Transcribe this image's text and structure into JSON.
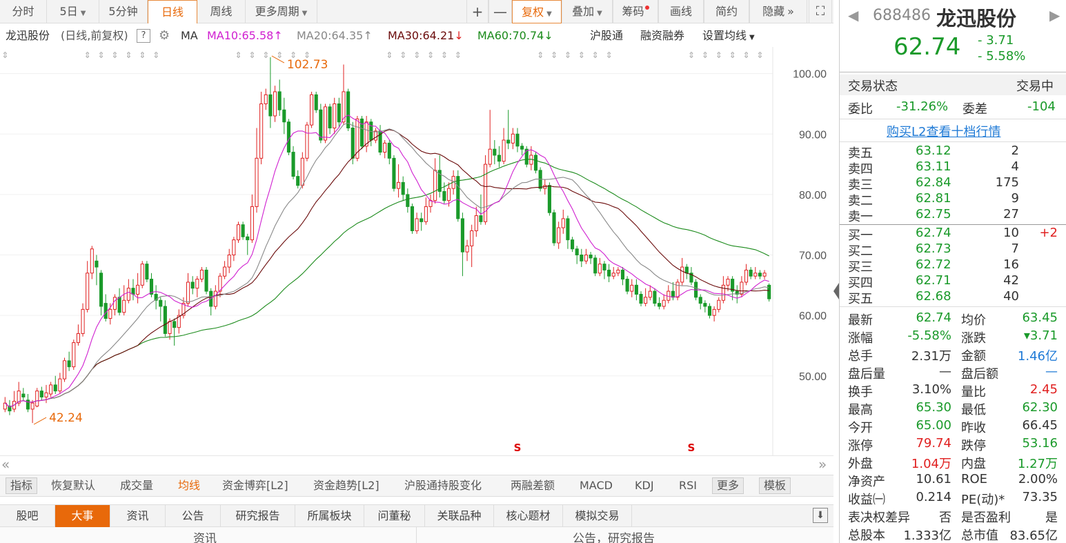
{
  "colors": {
    "up": "#e02020",
    "down": "#1a9a2a",
    "accent": "#e8690a",
    "ma10": "#d020d0",
    "ma20": "#888888",
    "ma30": "#6a0a0a",
    "ma60": "#1a8a1a"
  },
  "toolbar": {
    "items": [
      {
        "label": "分时",
        "w": 68
      },
      {
        "label": "5日",
        "w": 76,
        "caret": true
      },
      {
        "label": "5分钟",
        "w": 70
      },
      {
        "label": "日线",
        "w": 72,
        "active": true
      },
      {
        "label": "周线",
        "w": 70
      },
      {
        "label": "更多周期",
        "w": 104,
        "caret": true
      }
    ],
    "plus": "+",
    "minus": "—",
    "fuquan": "复权",
    "diejia": "叠加",
    "chouma": "筹码",
    "huaxian": "画线",
    "jianyue": "简约",
    "yincang": "隐藏",
    "expand": "»"
  },
  "ma_row": {
    "name": "龙迅股份",
    "sub": "(日线,前复权)",
    "q": "?",
    "ma": "MA",
    "ma10": "MA10:65.58",
    "ma20": "MA20:64.35",
    "ma30": "MA30:64.21",
    "ma60": "MA60:70.74",
    "hgt": "沪股通",
    "rzrq": "融资融券",
    "shezhi": "设置均线"
  },
  "chart_data": {
    "type": "candlestick",
    "y_ticks": [
      "100.00",
      "90.00",
      "80.00",
      "70.00",
      "60.00",
      "50.00"
    ],
    "ylim": [
      40.5,
      103.5
    ],
    "annotations": {
      "high": "102.73",
      "low": "42.24"
    },
    "marker": "S",
    "candles": [
      [
        44.5,
        45.5,
        44.0,
        46.5
      ],
      [
        45.0,
        44.2,
        43.5,
        46.0
      ],
      [
        44.5,
        45.8,
        44.0,
        47.5
      ],
      [
        45.5,
        47.5,
        45.0,
        49.0
      ],
      [
        47.0,
        46.5,
        45.8,
        48.0
      ],
      [
        46.0,
        44.5,
        44.0,
        47.0
      ],
      [
        44.5,
        45.5,
        42.2,
        46.0
      ],
      [
        45.0,
        47.5,
        44.8,
        48.0
      ],
      [
        47.5,
        46.5,
        46.0,
        48.2
      ],
      [
        46.5,
        47.2,
        45.5,
        48.5
      ],
      [
        47.0,
        48.5,
        46.5,
        49.0
      ],
      [
        48.5,
        47.5,
        47.0,
        50.0
      ],
      [
        47.5,
        49.5,
        47.0,
        50.5
      ],
      [
        49.5,
        52.5,
        49.0,
        53.0
      ],
      [
        52.5,
        51.5,
        50.8,
        54.0
      ],
      [
        51.5,
        55.5,
        51.0,
        56.0
      ],
      [
        55.5,
        57.0,
        55.0,
        58.5
      ],
      [
        57.0,
        61.0,
        56.5,
        62.0
      ],
      [
        61.0,
        67.0,
        60.5,
        69.0
      ],
      [
        67.0,
        71.0,
        66.0,
        71.5
      ],
      [
        69.0,
        68.0,
        65.0,
        70.0
      ],
      [
        67.0,
        61.5,
        60.0,
        67.5
      ],
      [
        62.0,
        59.5,
        59.0,
        63.5
      ],
      [
        59.5,
        61.0,
        58.5,
        62.0
      ],
      [
        61.0,
        63.0,
        60.0,
        63.5
      ],
      [
        63.0,
        60.5,
        60.0,
        64.5
      ],
      [
        60.5,
        62.5,
        60.0,
        65.0
      ],
      [
        62.5,
        64.5,
        62.0,
        66.0
      ],
      [
        64.5,
        63.5,
        62.5,
        66.0
      ],
      [
        63.5,
        65.0,
        62.0,
        67.0
      ],
      [
        65.0,
        68.5,
        64.5,
        69.0
      ],
      [
        68.5,
        66.0,
        65.5,
        69.0
      ],
      [
        66.0,
        63.5,
        63.0,
        67.0
      ],
      [
        63.5,
        62.5,
        61.0,
        65.0
      ],
      [
        62.5,
        61.5,
        59.0,
        63.0
      ],
      [
        61.5,
        57.0,
        56.5,
        62.5
      ],
      [
        57.0,
        59.0,
        56.0,
        59.5
      ],
      [
        59.0,
        58.0,
        55.0,
        59.5
      ],
      [
        58.0,
        60.0,
        57.0,
        61.0
      ],
      [
        60.0,
        62.0,
        59.5,
        63.0
      ],
      [
        62.0,
        65.5,
        61.5,
        67.0
      ],
      [
        65.5,
        64.5,
        63.5,
        66.5
      ],
      [
        64.5,
        66.0,
        63.0,
        66.5
      ],
      [
        66.0,
        67.5,
        65.5,
        68.0
      ],
      [
        67.5,
        64.0,
        63.5,
        68.0
      ],
      [
        64.0,
        61.5,
        60.0,
        64.5
      ],
      [
        61.5,
        64.0,
        61.0,
        65.0
      ],
      [
        64.0,
        66.5,
        63.0,
        67.0
      ],
      [
        66.5,
        68.0,
        66.0,
        69.0
      ],
      [
        68.0,
        70.0,
        67.0,
        71.0
      ],
      [
        70.0,
        72.5,
        69.0,
        73.0
      ],
      [
        72.5,
        75.0,
        72.0,
        75.5
      ],
      [
        75.0,
        73.0,
        72.5,
        75.5
      ],
      [
        73.0,
        72.5,
        70.0,
        73.5
      ],
      [
        72.5,
        78.0,
        72.0,
        80.0
      ],
      [
        78.0,
        86.0,
        77.0,
        91.0
      ],
      [
        86.0,
        95.0,
        85.0,
        97.0
      ],
      [
        95.0,
        96.5,
        94.0,
        97.5
      ],
      [
        96.5,
        93.0,
        91.0,
        102.7
      ],
      [
        93.0,
        97.0,
        92.0,
        98.0
      ],
      [
        97.0,
        94.0,
        93.0,
        99.0
      ],
      [
        94.0,
        92.0,
        90.0,
        96.0
      ],
      [
        92.0,
        87.0,
        86.5,
        92.5
      ],
      [
        87.0,
        83.0,
        82.5,
        88.0
      ],
      [
        83.0,
        81.5,
        81.0,
        84.0
      ],
      [
        81.5,
        86.0,
        81.0,
        87.0
      ],
      [
        86.0,
        91.5,
        85.5,
        92.0
      ],
      [
        91.5,
        96.5,
        91.0,
        97.0
      ],
      [
        96.5,
        94.0,
        93.5,
        97.0
      ],
      [
        94.0,
        89.0,
        88.5,
        95.0
      ],
      [
        89.0,
        94.5,
        88.5,
        95.0
      ],
      [
        94.5,
        91.0,
        90.0,
        95.0
      ],
      [
        91.0,
        95.0,
        90.0,
        96.0
      ],
      [
        95.0,
        92.0,
        91.0,
        96.0
      ],
      [
        92.0,
        97.0,
        91.5,
        101.5
      ],
      [
        97.0,
        91.0,
        90.5,
        97.5
      ],
      [
        91.0,
        86.0,
        85.0,
        92.0
      ],
      [
        86.0,
        92.5,
        85.5,
        93.0
      ],
      [
        92.5,
        88.0,
        87.5,
        93.0
      ],
      [
        88.0,
        92.0,
        87.0,
        93.0
      ],
      [
        92.0,
        89.0,
        88.0,
        92.5
      ],
      [
        89.0,
        90.5,
        88.5,
        91.0
      ],
      [
        90.5,
        87.0,
        86.5,
        91.5
      ],
      [
        87.0,
        88.5,
        86.0,
        89.0
      ],
      [
        88.5,
        86.0,
        85.0,
        89.0
      ],
      [
        86.0,
        81.0,
        80.5,
        86.5
      ],
      [
        81.0,
        82.0,
        79.5,
        85.0
      ],
      [
        82.0,
        80.0,
        79.0,
        83.0
      ],
      [
        80.0,
        78.0,
        77.0,
        81.0
      ],
      [
        78.0,
        74.0,
        73.5,
        78.5
      ],
      [
        74.0,
        76.0,
        73.5,
        77.0
      ],
      [
        76.0,
        75.5,
        74.0,
        77.0
      ],
      [
        75.5,
        78.0,
        75.0,
        79.5
      ],
      [
        78.0,
        79.0,
        77.0,
        80.0
      ],
      [
        79.0,
        84.0,
        78.5,
        86.0
      ],
      [
        84.0,
        80.5,
        79.5,
        86.5
      ],
      [
        80.5,
        79.0,
        78.5,
        82.0
      ],
      [
        79.0,
        81.0,
        78.0,
        82.0
      ],
      [
        81.0,
        83.0,
        80.0,
        84.0
      ],
      [
        83.0,
        76.0,
        75.5,
        84.0
      ],
      [
        76.0,
        70.5,
        66.5,
        77.0
      ],
      [
        70.5,
        71.5,
        69.0,
        72.5
      ],
      [
        71.5,
        74.0,
        68.0,
        75.0
      ],
      [
        74.0,
        76.5,
        73.0,
        78.0
      ],
      [
        76.5,
        75.5,
        75.0,
        80.0
      ],
      [
        75.5,
        85.0,
        75.0,
        86.5
      ],
      [
        85.0,
        87.5,
        84.5,
        94.0
      ],
      [
        87.5,
        86.5,
        85.0,
        89.0
      ],
      [
        86.5,
        85.5,
        84.5,
        88.0
      ],
      [
        85.5,
        89.0,
        85.0,
        91.0
      ],
      [
        89.0,
        88.5,
        87.5,
        94.0
      ],
      [
        88.5,
        90.0,
        87.5,
        91.0
      ],
      [
        90.0,
        88.0,
        87.0,
        91.0
      ],
      [
        88.0,
        87.5,
        86.5,
        88.5
      ],
      [
        87.5,
        85.0,
        84.5,
        88.0
      ],
      [
        85.0,
        86.5,
        84.0,
        88.0
      ],
      [
        86.5,
        84.0,
        83.5,
        87.0
      ],
      [
        84.0,
        81.0,
        80.5,
        84.5
      ],
      [
        81.0,
        81.5,
        80.0,
        82.5
      ],
      [
        81.5,
        77.0,
        76.5,
        82.0
      ],
      [
        77.0,
        72.0,
        71.5,
        77.5
      ],
      [
        72.0,
        74.5,
        71.0,
        75.5
      ],
      [
        74.5,
        76.0,
        73.5,
        77.5
      ],
      [
        76.0,
        72.5,
        71.0,
        76.5
      ],
      [
        72.5,
        71.0,
        70.5,
        73.0
      ],
      [
        71.0,
        70.0,
        68.5,
        71.5
      ],
      [
        70.0,
        69.0,
        68.0,
        71.0
      ],
      [
        69.0,
        70.0,
        68.5,
        71.0
      ],
      [
        70.0,
        69.5,
        68.5,
        70.5
      ],
      [
        69.5,
        67.0,
        66.5,
        70.0
      ],
      [
        67.0,
        68.5,
        66.5,
        69.5
      ],
      [
        68.5,
        67.5,
        66.0,
        69.0
      ],
      [
        67.5,
        66.5,
        65.5,
        68.5
      ],
      [
        66.5,
        67.0,
        66.0,
        68.0
      ],
      [
        67.0,
        67.5,
        66.5,
        68.0
      ],
      [
        67.5,
        66.0,
        65.0,
        68.0
      ],
      [
        66.0,
        64.0,
        63.5,
        66.5
      ],
      [
        64.0,
        65.0,
        63.0,
        66.0
      ],
      [
        65.0,
        63.5,
        62.5,
        66.0
      ],
      [
        63.5,
        62.0,
        61.5,
        64.0
      ],
      [
        62.0,
        63.0,
        61.5,
        64.5
      ],
      [
        63.0,
        64.0,
        62.5,
        65.0
      ],
      [
        64.0,
        62.0,
        61.5,
        64.5
      ],
      [
        62.0,
        61.5,
        61.0,
        63.0
      ],
      [
        61.5,
        62.5,
        61.0,
        63.5
      ],
      [
        62.5,
        64.0,
        62.0,
        65.0
      ],
      [
        64.0,
        63.0,
        62.5,
        65.5
      ],
      [
        63.0,
        65.5,
        62.5,
        66.0
      ],
      [
        65.5,
        68.0,
        65.0,
        69.5
      ],
      [
        68.0,
        67.0,
        66.0,
        68.5
      ],
      [
        67.0,
        65.5,
        65.0,
        68.0
      ],
      [
        65.5,
        63.0,
        62.5,
        66.0
      ],
      [
        63.0,
        62.0,
        61.0,
        63.5
      ],
      [
        62.0,
        61.5,
        60.5,
        62.5
      ],
      [
        61.5,
        60.0,
        59.5,
        62.0
      ],
      [
        60.0,
        61.0,
        59.0,
        61.5
      ],
      [
        61.0,
        62.5,
        60.5,
        63.0
      ],
      [
        62.5,
        65.0,
        62.0,
        66.5
      ],
      [
        65.0,
        66.0,
        64.0,
        66.5
      ],
      [
        66.0,
        64.0,
        62.5,
        66.5
      ],
      [
        64.0,
        63.5,
        62.0,
        65.0
      ],
      [
        63.5,
        65.5,
        63.0,
        66.5
      ],
      [
        65.5,
        67.5,
        65.0,
        68.5
      ],
      [
        67.5,
        66.5,
        66.0,
        68.0
      ],
      [
        66.5,
        67.0,
        66.0,
        68.0
      ],
      [
        67.0,
        66.5,
        66.0,
        67.5
      ],
      [
        66.5,
        67.0,
        66.0,
        67.5
      ],
      [
        65.0,
        62.74,
        62.3,
        65.3
      ]
    ]
  },
  "scroll": {
    "left": "«",
    "right": "»"
  },
  "ind_tabs": [
    {
      "label": "指标",
      "btn": true
    },
    {
      "label": "恢复默认"
    },
    {
      "label": "成交量"
    },
    {
      "label": "均线",
      "active": true
    },
    {
      "label": "资金博弈[L2]"
    },
    {
      "label": "资金趋势[L2]"
    },
    {
      "label": "沪股通持股变化"
    },
    {
      "label": "两融差额"
    },
    {
      "label": "MACD"
    },
    {
      "label": "KDJ"
    },
    {
      "label": "RSI"
    },
    {
      "label": "更多",
      "btn": true
    },
    {
      "label": "模板",
      "btn": true
    }
  ],
  "bottom_tabs": [
    {
      "label": "股吧",
      "w": 80
    },
    {
      "label": "大事",
      "w": 80,
      "active": true
    },
    {
      "label": "资讯",
      "w": 80
    },
    {
      "label": "公告",
      "w": 80
    },
    {
      "label": "研究报告",
      "w": 108
    },
    {
      "label": "所属板块",
      "w": 100
    },
    {
      "label": "问董秘",
      "w": 88
    },
    {
      "label": "关联品种",
      "w": 100
    },
    {
      "label": "核心题材",
      "w": 100
    },
    {
      "label": "模拟交易",
      "w": 100
    }
  ],
  "subhead": {
    "left": "资讯",
    "right": "公告，研究报告"
  },
  "quote": {
    "code": "688486",
    "name": "龙迅股份",
    "price": "62.74",
    "chg": "- 3.71",
    "pct": "- 5.58%",
    "nav_left": "◀",
    "nav_right": "▶",
    "status_label": "交易状态",
    "status_value": "交易中",
    "weibi_label": "委比",
    "weibi": "-31.26%",
    "weicha_label": "委差",
    "weicha": "-104",
    "l2_link": "购买L2查看十档行情",
    "asks": [
      {
        "label": "卖五",
        "p": "63.12",
        "v": "2"
      },
      {
        "label": "卖四",
        "p": "63.11",
        "v": "4"
      },
      {
        "label": "卖三",
        "p": "62.84",
        "v": "175"
      },
      {
        "label": "卖二",
        "p": "62.81",
        "v": "9"
      },
      {
        "label": "卖一",
        "p": "62.75",
        "v": "27"
      }
    ],
    "bids": [
      {
        "label": "买一",
        "p": "62.74",
        "v": "10",
        "d": "+2"
      },
      {
        "label": "买二",
        "p": "62.73",
        "v": "7",
        "d": ""
      },
      {
        "label": "买三",
        "p": "62.72",
        "v": "16",
        "d": ""
      },
      {
        "label": "买四",
        "p": "62.71",
        "v": "42",
        "d": ""
      },
      {
        "label": "买五",
        "p": "62.68",
        "v": "40",
        "d": ""
      }
    ],
    "stats": [
      [
        {
          "l": "最新",
          "v": "62.74",
          "c": "g"
        },
        {
          "l": "均价",
          "v": "63.45",
          "c": "g"
        }
      ],
      [
        {
          "l": "涨幅",
          "v": "-5.58%",
          "c": "g"
        },
        {
          "l": "涨跌",
          "v": "▾3.71",
          "c": "g"
        }
      ],
      [
        {
          "l": "总手",
          "v": "2.31万",
          "c": "k"
        },
        {
          "l": "金额",
          "v": "1.46亿",
          "c": "b"
        }
      ],
      [
        {
          "l": "盘后量",
          "v": "—",
          "c": "k"
        },
        {
          "l": "盘后额",
          "v": "—",
          "c": "b"
        }
      ],
      [
        {
          "l": "换手",
          "v": "3.10%",
          "c": "k"
        },
        {
          "l": "量比",
          "v": "2.45",
          "c": "r"
        }
      ],
      [
        {
          "l": "最高",
          "v": "65.30",
          "c": "g"
        },
        {
          "l": "最低",
          "v": "62.30",
          "c": "g"
        }
      ],
      [
        {
          "l": "今开",
          "v": "65.00",
          "c": "g"
        },
        {
          "l": "昨收",
          "v": "66.45",
          "c": "k"
        }
      ],
      [
        {
          "l": "涨停",
          "v": "79.74",
          "c": "r"
        },
        {
          "l": "跌停",
          "v": "53.16",
          "c": "g"
        }
      ],
      [
        {
          "l": "外盘",
          "v": "1.04万",
          "c": "r"
        },
        {
          "l": "内盘",
          "v": "1.27万",
          "c": "g"
        }
      ],
      [
        {
          "l": "净资产",
          "v": "10.61",
          "c": "k"
        },
        {
          "l": "ROE",
          "v": "2.00%",
          "c": "k"
        }
      ],
      [
        {
          "l": "收益㈠",
          "v": "0.214",
          "c": "k"
        },
        {
          "l": "PE(动)*",
          "v": "73.35",
          "c": "k"
        }
      ],
      [
        {
          "l": "表决权差异",
          "v": "否",
          "c": "k"
        },
        {
          "l": "是否盈利",
          "v": "是",
          "c": "k"
        }
      ],
      [
        {
          "l": "总股本",
          "v": "1.333亿",
          "c": "k"
        },
        {
          "l": "总市值",
          "v": "83.65亿",
          "c": "k"
        }
      ]
    ]
  }
}
